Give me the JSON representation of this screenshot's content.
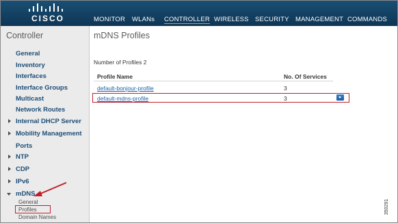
{
  "brand": {
    "logo_text": "CISCO"
  },
  "nav": {
    "monitor": "MONITOR",
    "wlans": "WLANs",
    "controller": "CONTROLLER",
    "wireless": "WIRELESS",
    "security": "SECURITY",
    "management": "MANAGEMENT",
    "commands": "COMMANDS",
    "active": "CONTROLLER"
  },
  "sidebar": {
    "title": "Controller",
    "items": [
      {
        "label": "General"
      },
      {
        "label": "Inventory"
      },
      {
        "label": "Interfaces"
      },
      {
        "label": "Interface Groups"
      },
      {
        "label": "Multicast"
      },
      {
        "label": "Network Routes"
      },
      {
        "label": "Internal DHCP Server",
        "arrow": "right"
      },
      {
        "label": "Mobility Management",
        "arrow": "right"
      },
      {
        "label": "Ports"
      },
      {
        "label": "NTP",
        "arrow": "right"
      },
      {
        "label": "CDP",
        "arrow": "right"
      },
      {
        "label": "IPv6",
        "arrow": "right"
      },
      {
        "label": "mDNS",
        "arrow": "down"
      }
    ],
    "mdns_subitems": [
      {
        "label": "General"
      },
      {
        "label": "Profiles",
        "selected": true
      },
      {
        "label": "Domain Names"
      }
    ]
  },
  "main": {
    "title": "mDNS Profiles",
    "count_label": "Number of Profiles",
    "count_value": "2",
    "table": {
      "headers": [
        "Profile Name",
        "No. Of Services"
      ],
      "rows": [
        {
          "name": "default-bonjour-profile",
          "services": "3"
        },
        {
          "name": "default-mdns-profile",
          "services": "3",
          "highlighted": true
        }
      ]
    }
  },
  "figure_code": "350291",
  "colors": {
    "header_bg": "#0e3555",
    "sidebar_bg": "#ebebeb",
    "sidebar_link": "#1d4d77",
    "table_link": "#1d5fa8",
    "highlight": "#c21d2a",
    "dropdown": "#1c5ba3"
  }
}
